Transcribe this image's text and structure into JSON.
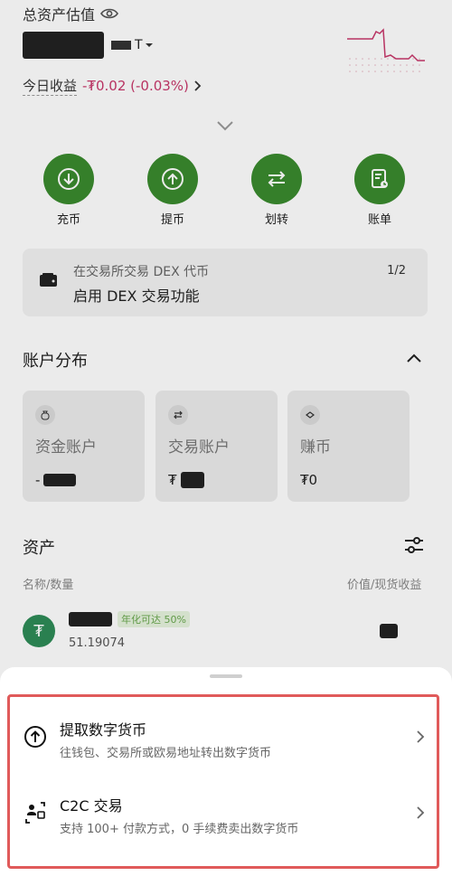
{
  "header": {
    "total_label": "总资产估值",
    "balance_unit": "T",
    "pnl_label": "今日收益",
    "pnl_value": "-₮0.02 (-0.03%)"
  },
  "actions": [
    {
      "label": "充币",
      "icon": "deposit-icon"
    },
    {
      "label": "提币",
      "icon": "withdraw-icon"
    },
    {
      "label": "划转",
      "icon": "transfer-icon"
    },
    {
      "label": "账单",
      "icon": "bill-icon"
    }
  ],
  "dex_card": {
    "line1": "在交易所交易 DEX 代币",
    "line2": "启用 DEX 交易功能",
    "page": "1/2"
  },
  "accounts": {
    "title": "账户分布",
    "items": [
      {
        "name": "资金账户",
        "value": "",
        "icon": "bag-icon"
      },
      {
        "name": "交易账户",
        "value": "₮",
        "icon": "swap-icon"
      },
      {
        "name": "赚币",
        "value": "₮0",
        "icon": "coin-icon"
      }
    ]
  },
  "assets": {
    "title": "资产",
    "col_left": "名称/数量",
    "col_right": "价值/现货收益",
    "rows": [
      {
        "name": "USDT",
        "badge": "年化可达 50%",
        "amount": "51.19074"
      }
    ]
  },
  "sheet": {
    "options": [
      {
        "title": "提取数字货币",
        "desc": "往钱包、交易所或欧易地址转出数字货币",
        "icon": "upload-icon"
      },
      {
        "title": "C2C 交易",
        "desc": "支持 100+ 付款方式，0 手续费卖出数字货币",
        "icon": "c2c-icon"
      }
    ]
  },
  "colors": {
    "accent_green": "#3a8a2e",
    "negative_red": "#c8386b",
    "highlight_border": "#e05a5a"
  }
}
